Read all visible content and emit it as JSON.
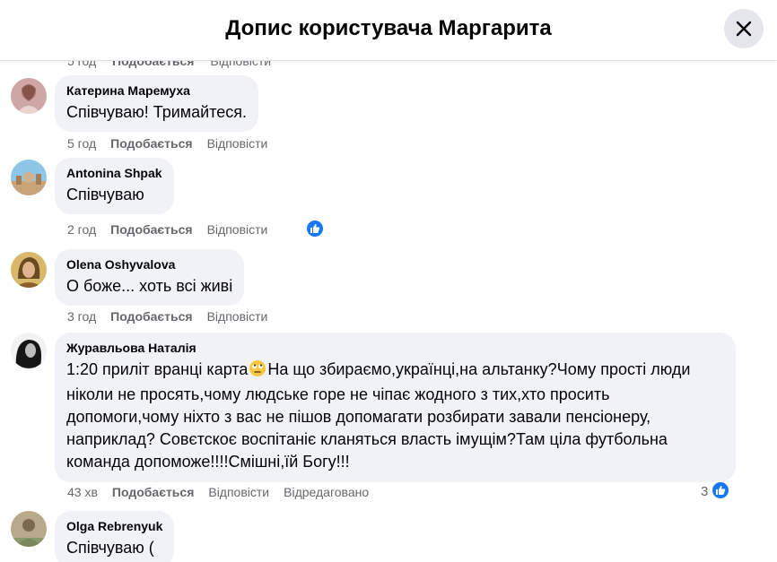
{
  "header": {
    "title": "Допис користувача Маргарита"
  },
  "peek": {
    "time": "5 год",
    "like": "Подобається",
    "reply": "Відповісти"
  },
  "comments": [
    {
      "author": "Катерина Маремуха",
      "text": "Співчуваю! Тримайтеся.",
      "time": "5 год",
      "like": "Подобається",
      "reply": "Відповісти"
    },
    {
      "author": "Antonina Shpak",
      "text": "Співчуваю",
      "time": "2 год",
      "like": "Подобається",
      "reply": "Відповісти",
      "reaction": "like"
    },
    {
      "author": "Olena Oshyvalova",
      "text": "О боже... хоть всі живі",
      "time": "3 год",
      "like": "Подобається",
      "reply": "Відповісти"
    },
    {
      "author": "Журавльова Наталія",
      "text_before": "1:20 приліт вранці карта",
      "text_after": "На що збираємо,українці,на альтанку?Чому прості люди ніколи не просять,чому людське горе не чіпає жодного з тих,хто просить допомоги,чому ніхто з вас не пішов допомагати розбирати завали пенсіонеру, наприклад? Совєтскоє воспітаніє кланяться власть імущім?Там ціла футбольна команда допоможе!!!!Смішні,їй Богу!!!",
      "time": "43 хв",
      "like": "Подобається",
      "reply": "Відповісти",
      "edited": "Відредаговано",
      "reaction": "like",
      "reaction_count": "3"
    },
    {
      "author": "Olga Rebrenyuk",
      "text": "Співчуваю ("
    }
  ],
  "colors": {
    "accent": "#1877f2",
    "bubble": "#f0f2f5",
    "meta": "#65676b"
  },
  "icons": {
    "close": "close-icon",
    "like": "thumbs-up-icon",
    "emoji": "rolling-eyes-emoji"
  }
}
